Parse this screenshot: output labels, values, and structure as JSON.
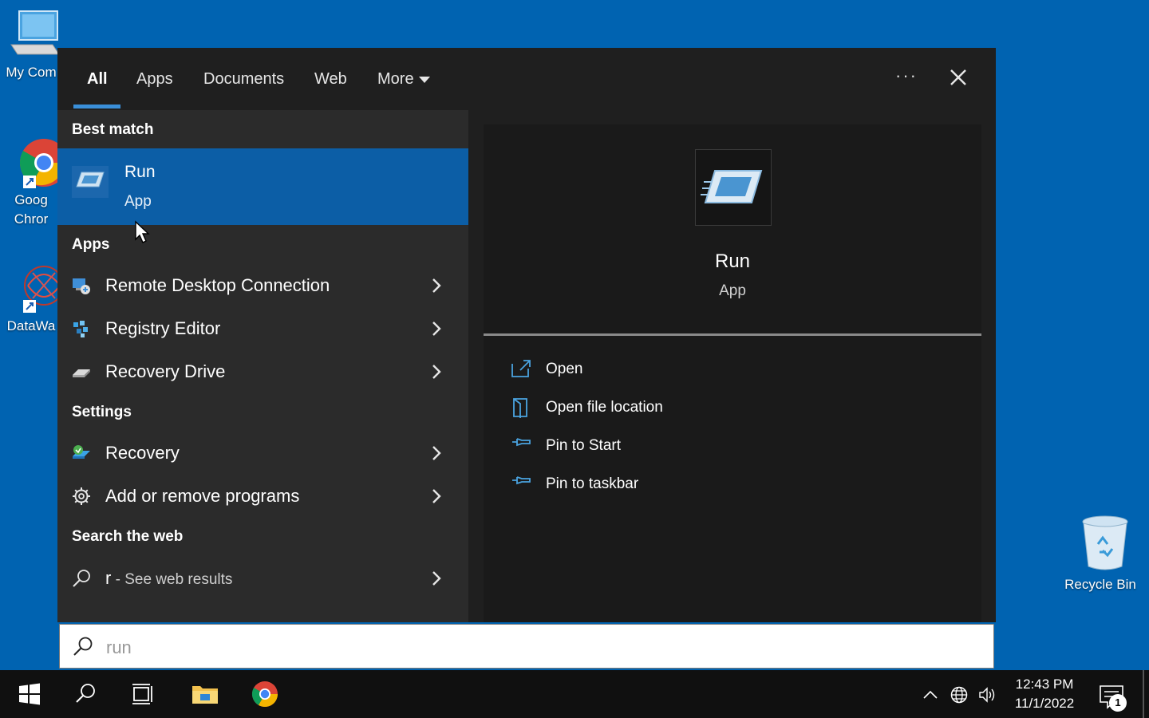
{
  "desktop": {
    "icons": [
      {
        "label": "My Com",
        "icon": "computer-icon"
      },
      {
        "label": "Goog\nChror",
        "icon": "chrome-icon"
      },
      {
        "label": "DataWa",
        "icon": "datawave-icon"
      },
      {
        "label": "Recycle Bin",
        "icon": "recycle-bin-icon"
      }
    ]
  },
  "search": {
    "tabs": [
      {
        "label": "All",
        "active": true
      },
      {
        "label": "Apps"
      },
      {
        "label": "Documents"
      },
      {
        "label": "Web"
      },
      {
        "label": "More"
      }
    ],
    "sections": {
      "best_match": "Best match",
      "apps": "Apps",
      "settings": "Settings",
      "web": "Search the web"
    },
    "best_match": {
      "title": "Run",
      "subtitle": "App"
    },
    "apps": [
      {
        "label": "Remote Desktop Connection"
      },
      {
        "label": "Registry Editor"
      },
      {
        "label": "Recovery Drive"
      }
    ],
    "settings": [
      {
        "label": "Recovery"
      },
      {
        "label": "Add or remove programs"
      }
    ],
    "web_result": {
      "query": "r",
      "suffix": " - See web results"
    },
    "preview": {
      "title": "Run",
      "subtitle": "App",
      "actions": [
        {
          "label": "Open",
          "icon": "open-icon"
        },
        {
          "label": "Open file location",
          "icon": "file-location-icon"
        },
        {
          "label": "Pin to Start",
          "icon": "pin-icon"
        },
        {
          "label": "Pin to taskbar",
          "icon": "pin-icon"
        }
      ]
    },
    "input_value": "run",
    "colors": {
      "selection": "#0c5ea6",
      "accent": "#3a8fd9",
      "desktop": "#0063b1"
    }
  },
  "taskbar": {
    "time": "12:43 PM",
    "date": "11/1/2022",
    "notification_count": "1"
  }
}
